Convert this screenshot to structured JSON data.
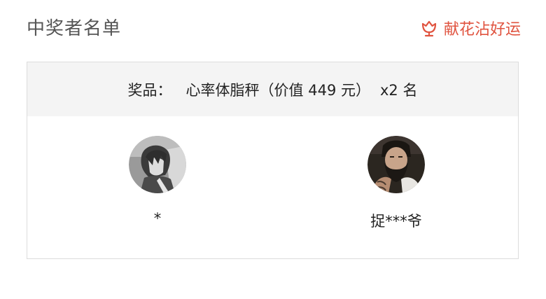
{
  "header": {
    "title": "中奖者名单",
    "blessing_label": "献花沾好运",
    "accent_color": "#e0533f",
    "blessing_icon": "flower-icon"
  },
  "prize": {
    "label": "奖品：",
    "name": "心率体脂秤（价值 449 元）",
    "count": "x2 名"
  },
  "winners": [
    {
      "name": "*",
      "avatar": "anime-girl-avatar"
    },
    {
      "name": "捉***爷",
      "avatar": "bearded-man-avatar"
    }
  ]
}
